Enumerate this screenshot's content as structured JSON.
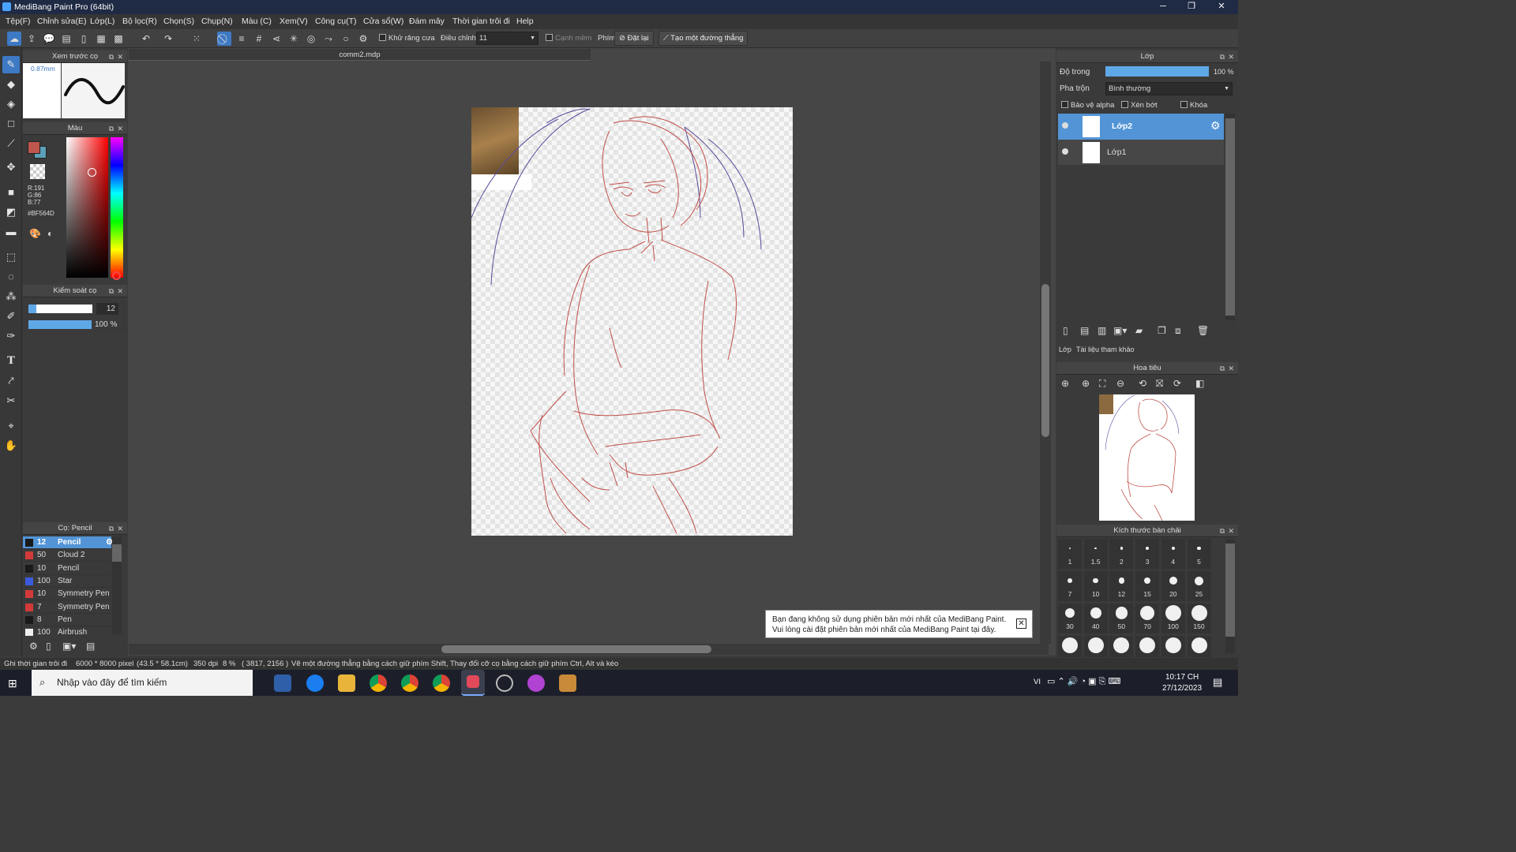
{
  "title": {
    "app": "MediBang Paint Pro (64bit)"
  },
  "menu": [
    "Tệp(F)",
    "Chỉnh sửa(E)",
    "Lớp(L)",
    "Bộ lọc(R)",
    "Chọn(S)",
    "Chụp(N)",
    "Màu (C)",
    "Xem(V)",
    "Công cụ(T)",
    "Cửa sổ(W)",
    "Đám mây",
    "Thời gian trôi đi",
    "Help"
  ],
  "toolbar": {
    "antialias_label": "Khử răng cưa",
    "adjust_label": "Điều chỉnh",
    "adjust_value": "11",
    "soft_edge_label": "Cạnh mềm",
    "key_label": "Phím",
    "reset_label": "Đặt lại",
    "line_label": "Tạo một đường thẳng"
  },
  "document": {
    "tab": "comm2.mdp"
  },
  "brush_preview": {
    "title": "Xem trước cọ",
    "size": "0.87mm"
  },
  "color_panel": {
    "title": "Màu",
    "r": "R:191",
    "g": "G:86",
    "b": "B:77",
    "hex": "#BF564D",
    "main_color": "#BF564D",
    "sub_color": "#5aa0b8"
  },
  "brush_control": {
    "title": "Kiểm soát cọ",
    "size": "12",
    "opacity": "100 %",
    "size_fraction": 0.12,
    "opacity_fraction": 1.0
  },
  "brush_list": {
    "title": "Cọ: Pencil",
    "items": [
      {
        "size": "12",
        "name": "Pencil",
        "color": "#1a1a1a"
      },
      {
        "size": "50",
        "name": "Cloud 2",
        "color": "#d23a3a"
      },
      {
        "size": "10",
        "name": "Pencil",
        "color": "#1a1a1a"
      },
      {
        "size": "100",
        "name": "Star",
        "color": "#3b5bdc"
      },
      {
        "size": "10",
        "name": "Symmetry Pen",
        "color": "#d23a3a"
      },
      {
        "size": "7",
        "name": "Symmetry Pen",
        "color": "#d23a3a"
      },
      {
        "size": "8",
        "name": "Pen",
        "color": "#1a1a1a"
      },
      {
        "size": "100",
        "name": "Airbrush",
        "color": "#eeeeee"
      }
    ]
  },
  "layer_panel": {
    "title": "Lớp",
    "opacity_label": "Độ trong",
    "opacity_value": "100 %",
    "opacity_fraction": 1.0,
    "blend_label": "Pha trộn",
    "blend_value": "Bình thường",
    "protect_alpha": "Bảo vệ alpha",
    "clipping": "Xén bớt",
    "lock": "Khóa",
    "layers": [
      "Lớp2",
      "Lớp1"
    ],
    "tabs": [
      "Lớp",
      "Tài liệu tham khảo"
    ]
  },
  "navigator": {
    "title": "Hoa tiêu"
  },
  "brush_size_panel": {
    "title": "Kích thước bàn chải",
    "sizes": [
      "1",
      "1.5",
      "2",
      "3",
      "4",
      "5",
      "7",
      "10",
      "12",
      "15",
      "20",
      "25",
      "30",
      "40",
      "50",
      "70",
      "100",
      "150"
    ]
  },
  "notification": {
    "line1": "Bạn đang không sử dụng phiên bản mới nhất của MediBang Paint.",
    "line2": "Vui lòng cài đặt phiên bản mới nhất của MediBang Paint tại đây."
  },
  "status": {
    "timelapse": "Ghi thời gian trôi đi",
    "size": "6000 * 8000 pixel",
    "cm": "(43.5 * 58.1cm)",
    "dpi": "350 dpi",
    "zoom": "8 %",
    "coords": "( 3817, 2156 )",
    "hint": "Vẽ một đường thẳng bằng cách giữ phím Shift, Thay đổi cỡ cọ bằng cách giữ phím Ctrl, Alt và kéo"
  },
  "taskbar": {
    "search_placeholder": "Nhập vào đây để tìm kiếm",
    "lang": "VI",
    "time": "10:17 CH",
    "date": "27/12/2023"
  }
}
